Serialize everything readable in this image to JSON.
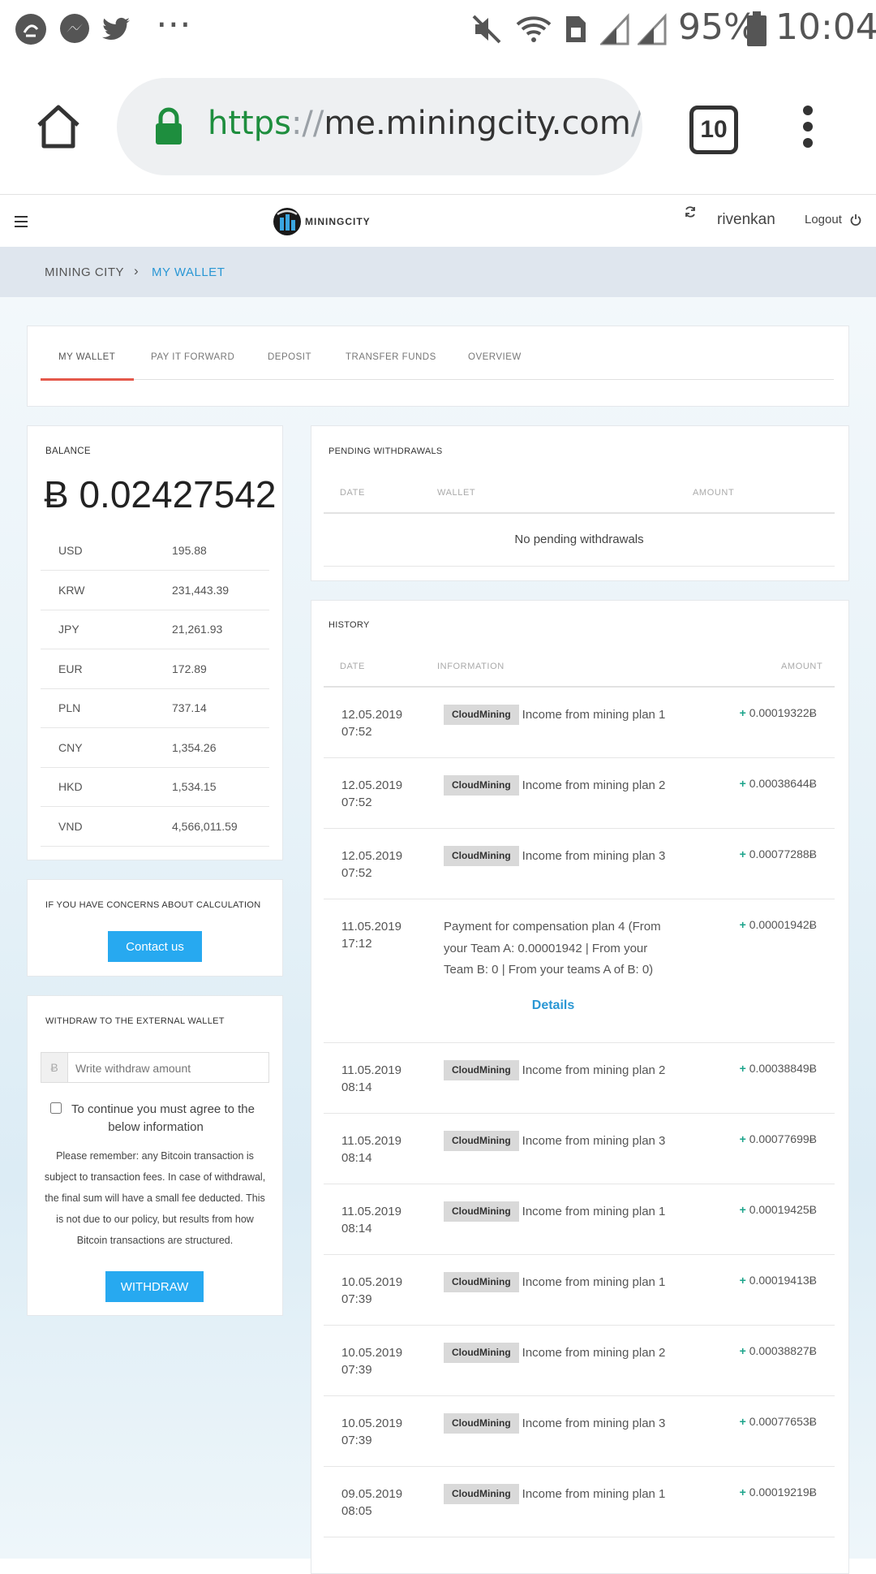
{
  "status_bar": {
    "battery": "95%",
    "time": "10:04"
  },
  "browser": {
    "url_scheme": "https",
    "url_sep": "://",
    "url_host": "me.miningcity.com",
    "url_path": "/my",
    "tab_count": "10"
  },
  "header": {
    "logo_text": "MININGCITY",
    "username": "rivenkan",
    "logout_label": "Logout"
  },
  "breadcrumb": {
    "root": "MINING CITY",
    "separator": "›",
    "current": "MY WALLET"
  },
  "tabs": [
    {
      "label": "MY WALLET",
      "active": true
    },
    {
      "label": "PAY IT FORWARD"
    },
    {
      "label": "DEPOSIT"
    },
    {
      "label": "TRANSFER FUNDS"
    },
    {
      "label": "OVERVIEW"
    }
  ],
  "balance": {
    "title": "BALANCE",
    "amount": "Ƀ 0.02427542",
    "currencies": [
      {
        "code": "USD",
        "value": "195.88"
      },
      {
        "code": "KRW",
        "value": "231,443.39"
      },
      {
        "code": "JPY",
        "value": "21,261.93"
      },
      {
        "code": "EUR",
        "value": "172.89"
      },
      {
        "code": "PLN",
        "value": "737.14"
      },
      {
        "code": "CNY",
        "value": "1,354.26"
      },
      {
        "code": "HKD",
        "value": "1,534.15"
      },
      {
        "code": "VND",
        "value": "4,566,011.59"
      }
    ]
  },
  "concerns": {
    "title": "IF YOU HAVE CONCERNS ABOUT CALCULATION",
    "button": "Contact us"
  },
  "withdraw": {
    "title": "WITHDRAW TO THE EXTERNAL WALLET",
    "currency_symbol": "Ƀ",
    "placeholder": "Write withdraw amount",
    "agree_label": "To continue you must agree to the below information",
    "note": "Please remember: any Bitcoin transaction is subject to transaction fees. In case of withdrawal, the final sum will have a small fee deducted. This is not due to our policy, but results from how Bitcoin transactions are structured.",
    "button": "WITHDRAW"
  },
  "pending": {
    "title": "PENDING WITHDRAWALS",
    "columns": [
      "DATE",
      "WALLET",
      "AMOUNT"
    ],
    "empty": "No pending withdrawals"
  },
  "history": {
    "title": "HISTORY",
    "columns": [
      "DATE",
      "INFORMATION",
      "AMOUNT"
    ],
    "details_label": "Details",
    "rows": [
      {
        "date": "12.05.2019",
        "time": "07:52",
        "badge": "CloudMining",
        "info": "Income from mining plan 1",
        "amount": "0.00019322Ƀ"
      },
      {
        "date": "12.05.2019",
        "time": "07:52",
        "badge": "CloudMining",
        "info": "Income from mining plan 2",
        "amount": "0.00038644Ƀ"
      },
      {
        "date": "12.05.2019",
        "time": "07:52",
        "badge": "CloudMining",
        "info": "Income from mining plan 3",
        "amount": "0.00077288Ƀ"
      },
      {
        "date": "11.05.2019",
        "time": "17:12",
        "badge": "",
        "info": "Payment for compensation plan 4 (From your Team A: 0.00001942 | From your Team B: 0 | From your teams A of B: 0)",
        "amount": "0.00001942Ƀ"
      },
      {
        "date": "11.05.2019",
        "time": "08:14",
        "badge": "CloudMining",
        "info": "Income from mining plan 2",
        "amount": "0.00038849Ƀ"
      },
      {
        "date": "11.05.2019",
        "time": "08:14",
        "badge": "CloudMining",
        "info": "Income from mining plan 3",
        "amount": "0.00077699Ƀ"
      },
      {
        "date": "11.05.2019",
        "time": "08:14",
        "badge": "CloudMining",
        "info": "Income from mining plan 1",
        "amount": "0.00019425Ƀ"
      },
      {
        "date": "10.05.2019",
        "time": "07:39",
        "badge": "CloudMining",
        "info": "Income from mining plan 1",
        "amount": "0.00019413Ƀ"
      },
      {
        "date": "10.05.2019",
        "time": "07:39",
        "badge": "CloudMining",
        "info": "Income from mining plan 2",
        "amount": "0.00038827Ƀ"
      },
      {
        "date": "10.05.2019",
        "time": "07:39",
        "badge": "CloudMining",
        "info": "Income from mining plan 3",
        "amount": "0.00077653Ƀ"
      },
      {
        "date": "09.05.2019",
        "time": "08:05",
        "badge": "CloudMining",
        "info": "Income from mining plan 1",
        "amount": "0.00019219Ƀ"
      }
    ]
  }
}
